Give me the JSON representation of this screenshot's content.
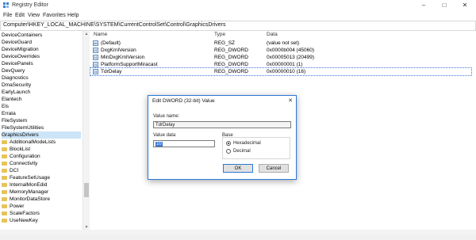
{
  "window": {
    "title": "Registry Editor",
    "min": "–",
    "max": "□",
    "close": "✕"
  },
  "menu": [
    "File",
    "Edit",
    "View",
    "Favorites",
    "Help"
  ],
  "address": "Computer\\HKEY_LOCAL_MACHINE\\SYSTEM\\CurrentControlSet\\Control\\GraphicsDrivers",
  "tree": {
    "items": [
      "DeviceContainers",
      "DeviceGuard",
      "DeviceMigration",
      "DeviceOverrides",
      "DevicePanels",
      "DevQuery",
      "Diagnostics",
      "DmaSecurity",
      "EarlyLaunch",
      "Elantech",
      "Els",
      "Errata",
      "FileSystem",
      "FileSystemUtilities",
      "GraphicsDrivers"
    ],
    "children": [
      "AdditionalModeLists",
      "BlockList",
      "Configuration",
      "Connectivity",
      "DCI",
      "FeatureSetUsage",
      "InternalMonEdid",
      "MemoryManager",
      "MonitorDataStore",
      "Power",
      "ScaleFactors",
      "UseNewKey"
    ]
  },
  "list": {
    "headers": {
      "name": "Name",
      "type": "Type",
      "data": "Data"
    },
    "rows": [
      {
        "name": "(Default)",
        "type": "REG_SZ",
        "data": "(value not set)",
        "icon": "ab"
      },
      {
        "name": "DxgKrnlVersion",
        "type": "REG_DWORD",
        "data": "0x0000b004 (45060)",
        "icon": "01"
      },
      {
        "name": "MinDxgKrnlVersion",
        "type": "REG_DWORD",
        "data": "0x00005013 (20499)",
        "icon": "01"
      },
      {
        "name": "PlatformSupportMiracast",
        "type": "REG_DWORD",
        "data": "0x00000001 (1)",
        "icon": "01"
      },
      {
        "name": "TdrDelay",
        "type": "REG_DWORD",
        "data": "0x00000010 (16)",
        "icon": "01"
      }
    ]
  },
  "dialog": {
    "title": "Edit DWORD (32-bit) Value",
    "close": "✕",
    "value_name_label": "Value name:",
    "value_name": "TdrDelay",
    "value_data_label": "Value data",
    "value_data": "10",
    "base_label": "Base",
    "hex_label": "Hexadecimal",
    "dec_label": "Decimal",
    "ok": "OK",
    "cancel": "Cancel"
  },
  "colors": {
    "selection": "#cce4f7",
    "accent": "#2b78d4",
    "folder": "#e8c35a"
  }
}
